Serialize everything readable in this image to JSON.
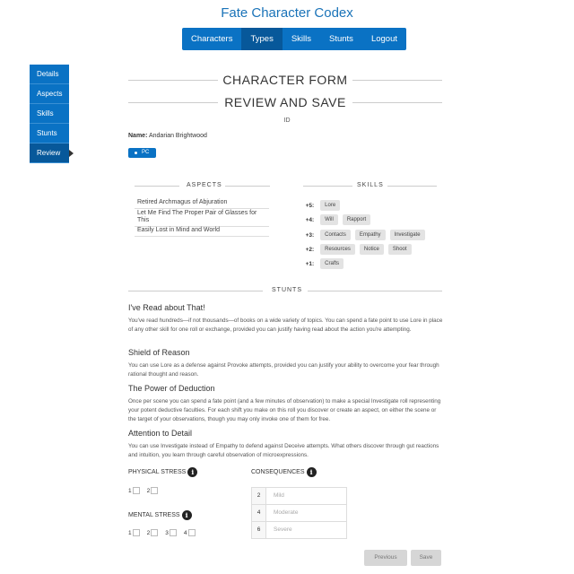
{
  "app": {
    "title": "Fate Character Codex"
  },
  "topnav": [
    "Characters",
    "Types",
    "Skills",
    "Stunts",
    "Logout"
  ],
  "topnav_active": "Types",
  "sidenav": [
    "Details",
    "Aspects",
    "Skills",
    "Stunts",
    "Review"
  ],
  "sidenav_active": "Review",
  "form": {
    "title": "CHARACTER FORM",
    "subtitle": "REVIEW AND SAVE",
    "id_label": "ID",
    "name_label": "Name:",
    "name_value": "Andarian Brightwood",
    "type_tag": "PC"
  },
  "aspects": {
    "heading": "ASPECTS",
    "items": [
      "Retired Archmagus of Abjuration",
      "Let Me Find The Proper Pair of Glasses for This",
      "Easily Lost in Mind and World"
    ]
  },
  "skills": {
    "heading": "SKILLS",
    "rows": [
      {
        "level": "+5",
        "skills": [
          "Lore"
        ]
      },
      {
        "level": "+4",
        "skills": [
          "Will",
          "Rapport"
        ]
      },
      {
        "level": "+3",
        "skills": [
          "Contacts",
          "Empathy",
          "Investigate"
        ]
      },
      {
        "level": "+2",
        "skills": [
          "Resources",
          "Notice",
          "Shoot"
        ]
      },
      {
        "level": "+1",
        "skills": [
          "Crafts"
        ]
      }
    ]
  },
  "stunts": {
    "heading": "STUNTS",
    "items": [
      {
        "title": "I've Read about That!",
        "desc": "You've read hundreds—if not thousands—of books on a wide variety of topics. You can spend a fate point to use Lore in place of any other skill for one roll or exchange, provided you can justify having read about the action you're attempting."
      },
      {
        "title": "Shield of Reason",
        "desc": "You can use Lore as a defense against Provoke attempts, provided you can justify your ability to overcome your fear through rational thought and reason."
      },
      {
        "title": "The Power of Deduction",
        "desc": "Once per scene you can spend a fate point (and a few minutes of observation) to make a special Investigate roll representing your potent deductive faculties. For each shift you make on this roll you discover or create an aspect, on either the scene or the target of your observations, though you may only invoke one of them for free."
      },
      {
        "title": "Attention to Detail",
        "desc": "You can use Investigate instead of Empathy to defend against Deceive attempts. What others discover through gut reactions and intuition, you learn through careful observation of microexpressions."
      }
    ]
  },
  "stress": {
    "physical_label": "PHYSICAL STRESS",
    "physical_boxes": [
      "1",
      "2"
    ],
    "mental_label": "MENTAL STRESS",
    "mental_boxes": [
      "1",
      "2",
      "3",
      "4"
    ]
  },
  "consequences": {
    "label": "CONSEQUENCES",
    "rows": [
      {
        "value": "2",
        "placeholder": "Mild"
      },
      {
        "value": "4",
        "placeholder": "Moderate"
      },
      {
        "value": "6",
        "placeholder": "Severe"
      }
    ]
  },
  "buttons": {
    "previous": "Previous",
    "save": "Save"
  },
  "icons": {
    "info": "info-icon"
  },
  "colors": {
    "primary": "#0a72c4",
    "primary_dark": "#07589a"
  }
}
